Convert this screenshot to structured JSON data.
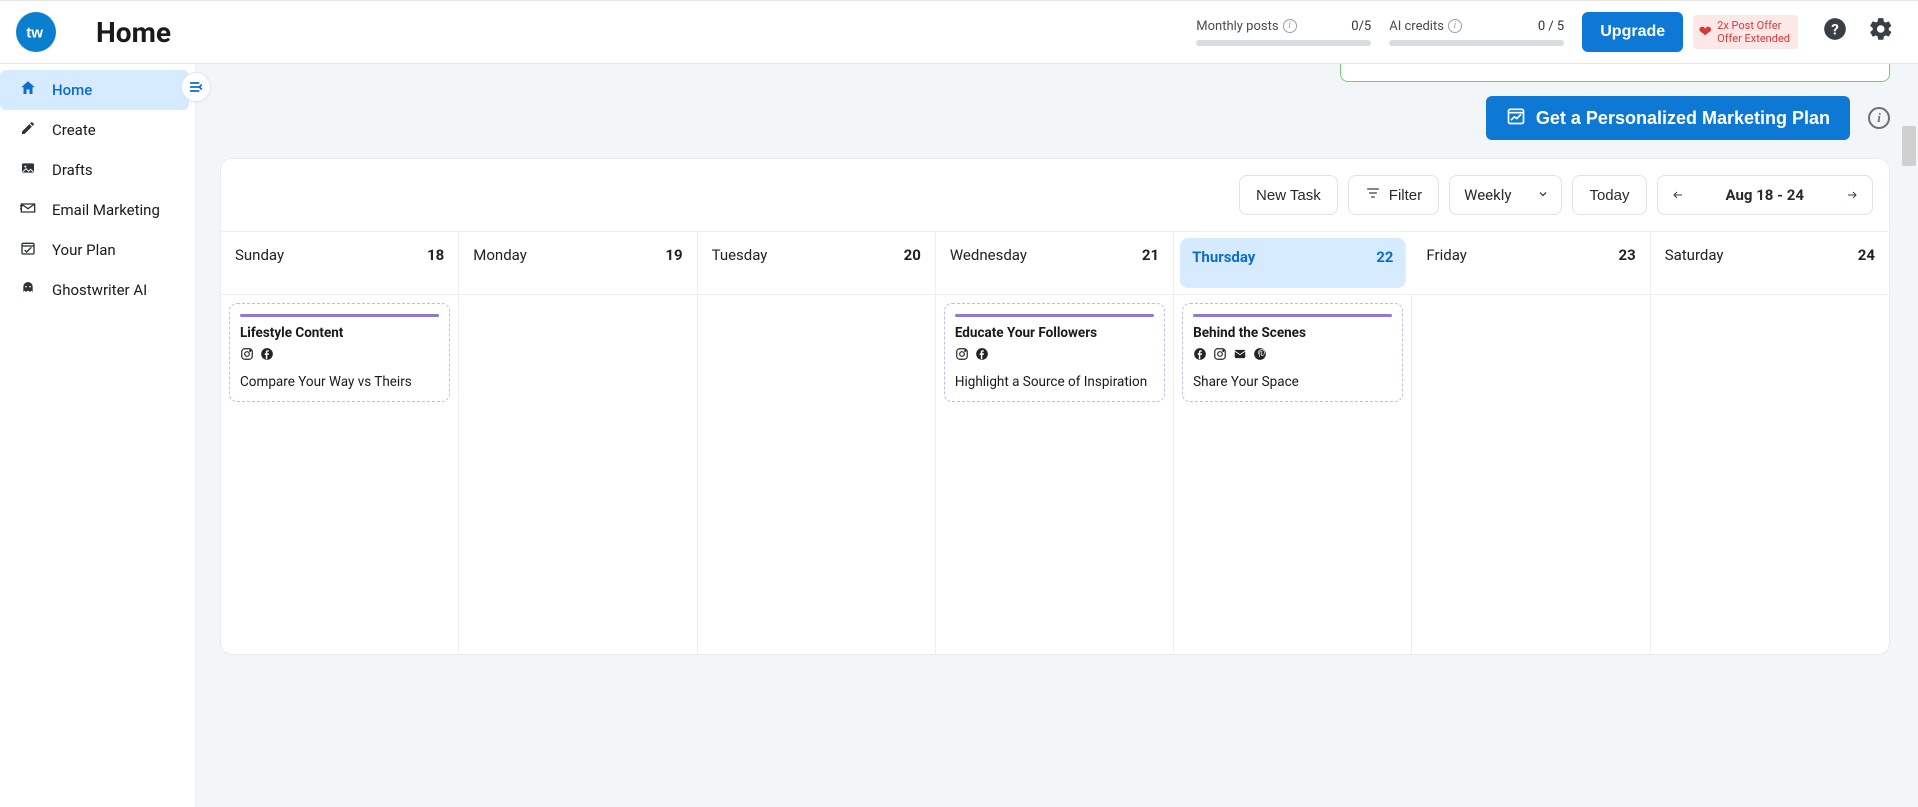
{
  "header": {
    "page_title": "Home",
    "meters": [
      {
        "label": "Monthly posts",
        "value": "0/5"
      },
      {
        "label": "AI credits",
        "value": "0 / 5"
      }
    ],
    "upgrade_label": "Upgrade",
    "offer_line1": "2x Post Offer",
    "offer_line2": "Offer Extended"
  },
  "sidebar": {
    "items": [
      {
        "label": "Home",
        "icon": "home",
        "active": true
      },
      {
        "label": "Create",
        "icon": "pencil",
        "active": false
      },
      {
        "label": "Drafts",
        "icon": "image",
        "active": false
      },
      {
        "label": "Email Marketing",
        "icon": "mail",
        "active": false
      },
      {
        "label": "Your Plan",
        "icon": "calendar",
        "active": false
      },
      {
        "label": "Ghostwriter AI",
        "icon": "ghost",
        "active": false
      }
    ]
  },
  "plan_button": "Get a Personalized Marketing Plan",
  "toolbar": {
    "new_task": "New Task",
    "filter": "Filter",
    "view": "Weekly",
    "today": "Today",
    "range": "Aug 18 - 24"
  },
  "days": [
    {
      "name": "Sunday",
      "num": "18",
      "today": false
    },
    {
      "name": "Monday",
      "num": "19",
      "today": false
    },
    {
      "name": "Tuesday",
      "num": "20",
      "today": false
    },
    {
      "name": "Wednesday",
      "num": "21",
      "today": false
    },
    {
      "name": "Thursday",
      "num": "22",
      "today": true
    },
    {
      "name": "Friday",
      "num": "23",
      "today": false
    },
    {
      "name": "Saturday",
      "num": "24",
      "today": false
    }
  ],
  "tasks": {
    "sunday": {
      "title": "Lifestyle Content",
      "sub": "Compare Your Way vs Theirs",
      "icons": [
        "instagram",
        "facebook"
      ]
    },
    "wednesday": {
      "title": "Educate Your Followers",
      "sub": "Highlight a Source of Inspiration",
      "icons": [
        "instagram",
        "facebook"
      ]
    },
    "thursday": {
      "title": "Behind the Scenes",
      "sub": "Share Your Space",
      "icons": [
        "facebook",
        "instagram",
        "mail",
        "pinterest"
      ]
    }
  }
}
